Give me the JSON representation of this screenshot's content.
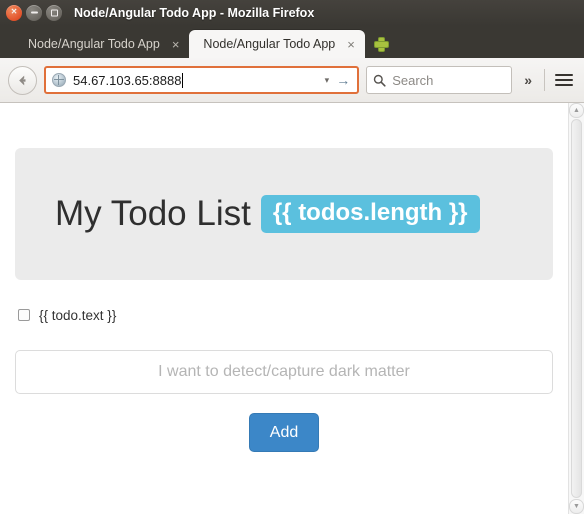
{
  "window": {
    "title": "Node/Angular Todo App - Mozilla Firefox",
    "controls": {
      "close_label": "×",
      "minimize_label": "",
      "maximize_label": ""
    }
  },
  "tabs": [
    {
      "label": "Node/Angular Todo App",
      "close_label": "×",
      "active": false
    },
    {
      "label": "Node/Angular Todo App",
      "close_label": "×",
      "active": true
    }
  ],
  "new_tab": {
    "label": "+"
  },
  "toolbar": {
    "back_label": "←",
    "url_value": "54.67.103.65:8888",
    "url_dropdown_label": "▾",
    "url_go_label": "→",
    "search_placeholder": "Search",
    "search_value": "",
    "overflow_label": "»",
    "menu_label": ""
  },
  "page": {
    "heading": "My Todo List",
    "badge": "{{ todos.length }}",
    "todos": [
      {
        "text": "{{ todo.text }}",
        "checked": false
      }
    ],
    "new_todo": {
      "value": "",
      "placeholder": "I want to detect/capture dark matter"
    },
    "add_label": "Add"
  },
  "scrollbar": {
    "up_label": "▲",
    "down_label": "▼"
  },
  "colors": {
    "badge": "#5bc0de",
    "add_button": "#3c87c8",
    "jumbotron": "#ebebeb",
    "url_focus_border": "#e0703a",
    "titlebar": "#3a3833",
    "new_tab_plus": "#a8c13f"
  }
}
